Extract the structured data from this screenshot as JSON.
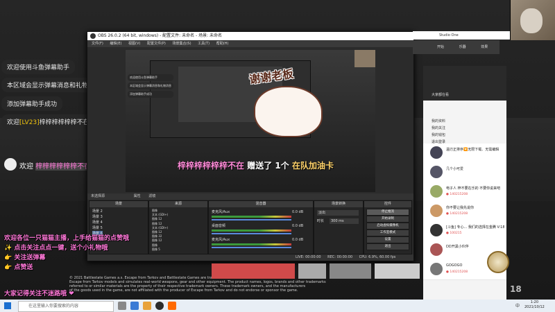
{
  "chat": {
    "messages": [
      "欢迎使用斗鱼弹幕助手",
      "本区域会显示弹幕消息和礼物消息",
      "添加弹幕助手成功"
    ],
    "welcome_prefix": "欢迎",
    "welcome_level": "[LV23]",
    "welcome_suffix": "梓梓梓梓梓梓不在进入直播间",
    "big_welcome_prefix": "欢迎",
    "big_welcome_name": "梓梓梓梓梓梓不在"
  },
  "obs": {
    "title": "OBS 26.0.2 (64 bit, windows) - 配置文件: 未命名 - 场景: 未命名",
    "menu": [
      "文件(F)",
      "编辑(E)",
      "视图(V)",
      "配置文件(P)",
      "场景集合(S)",
      "工具(T)",
      "帮助(H)"
    ],
    "source_status": "未选择源",
    "properties_label": "属性",
    "filters_label": "滤镜",
    "docks": {
      "scenes": {
        "header": "场景",
        "items": [
          "场景 2",
          "场景 3",
          "场景 4",
          "场景 5",
          "场景 6"
        ]
      },
      "sources": {
        "header": "来源",
        "items": [
          "图像",
          "文本 (GDI+)",
          "图像 12",
          "图像 12",
          "文本 (GDI+)",
          "图像 12",
          "图像 32",
          "图像 12",
          "图像",
          "图像 5"
        ]
      },
      "mixer": {
        "header": "混音器",
        "tracks": [
          {
            "name": "麦克风/Aux",
            "db": "0.0 dB"
          },
          {
            "name": "桌面音频",
            "db": "0.0 dB"
          },
          {
            "name": "麦克风/Aux",
            "db": "0.0 dB"
          }
        ]
      },
      "transitions": {
        "header": "场景转换",
        "transition": "淡出",
        "duration_label": "时长",
        "duration_value": "300 ms"
      },
      "controls": {
        "header": "控件",
        "buttons": [
          "停止推流",
          "开始录制",
          "启动虚拟摄像机",
          "工作室模式",
          "设置",
          "退出"
        ]
      }
    },
    "status": {
      "live": "LIVE: 00:00:00",
      "rec": "REC: 00:00:00",
      "cpu": "CPU: 6.9%, 60.00 fps"
    },
    "preview_overlay": {
      "sticker_text": "谢谢老板",
      "donation_name": "梓梓梓梓梓梓不在",
      "donation_action": "赠送了",
      "donation_qty": "1个",
      "donation_gift": "在队加油卡"
    },
    "preview_chat": [
      "欢迎使用斗鱼弹幕助手",
      "本区域会显示弹幕消息和礼物消息",
      "添加弹幕助手成功"
    ]
  },
  "right_panel": {
    "topbar_app": "Studio One",
    "topbar_tabs": [
      "开始",
      "乐器",
      "效果"
    ],
    "tab_title": "大家都在看",
    "menu": [
      "我的资料",
      "我的关注",
      "我的钱包",
      "退出登录"
    ],
    "rows": [
      {
        "name": "温刃正排序🔽无限下载、无需编辑",
        "sub": ""
      },
      {
        "name": "几个小可爱",
        "sub": ""
      },
      {
        "name": "电子人 梓不要在乐的 不要你说来吧",
        "sub": "● 140215208"
      },
      {
        "name": "你不要让我先说你",
        "sub": "● 140215208"
      },
      {
        "name": "[斗鱼] 专心... 我们的选择在金腾 V:181",
        "sub": "● 100215"
      },
      {
        "name": "DD开黑小伙伴",
        "sub": ""
      },
      {
        "name": "GOGOGO",
        "sub": "● 140215208"
      }
    ]
  },
  "bottom_overlay": {
    "lines": [
      "欢迎各位一只猫猫主播，上手给猫猫的点赞哦",
      "✨ 点击关注点点一键，送个小礼物哦",
      "👉 关注送弹幕",
      "👉 点赞送",
      "大家记得关注不迷路哦 ❤"
    ],
    "copyright": [
      "© 2021 Battlestate Games a.s. Escape from Tarkov and Battlestate Games are trademarks of Battlestate Games a.s.",
      "Escape from Tarkov models and simulates real-world weapons, gear and other equipment. The product names, logos, brands and other trademarks",
      "referred to or similar materials are the property of their respective trademark owners. These trademark owners, and the manufacturers",
      "of the goods used in the game, are not affiliated with the producer of Escape from Tarkov and do not endorse or sponsor the game."
    ]
  },
  "taskbar": {
    "search_placeholder": "在这里输入你要搜索的内容",
    "time": "1:20",
    "date": "2021/10/12",
    "lang": "中"
  },
  "badge_number": "18"
}
